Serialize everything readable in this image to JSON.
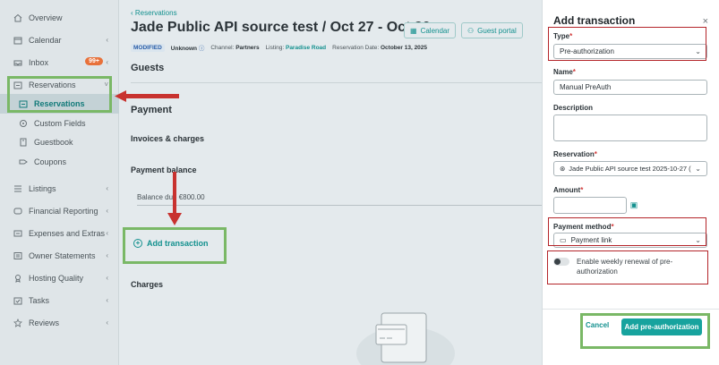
{
  "sidebar": {
    "items": [
      {
        "label": "Overview",
        "icon": "home-icon"
      },
      {
        "label": "Calendar",
        "icon": "calendar-icon"
      },
      {
        "label": "Inbox",
        "icon": "inbox-icon",
        "badge": "99+"
      },
      {
        "label": "Reservations",
        "icon": "calendar-check-icon"
      },
      {
        "label": "Reservations",
        "icon": "calendar-check-icon"
      },
      {
        "label": "Custom Fields",
        "icon": "tag-icon"
      },
      {
        "label": "Guestbook",
        "icon": "book-icon"
      },
      {
        "label": "Coupons",
        "icon": "coupon-icon"
      },
      {
        "label": "Listings",
        "icon": "list-icon"
      },
      {
        "label": "Financial Reporting",
        "icon": "chart-icon"
      },
      {
        "label": "Expenses and Extras",
        "icon": "receipt-icon"
      },
      {
        "label": "Owner Statements",
        "icon": "statement-icon"
      },
      {
        "label": "Hosting Quality",
        "icon": "quality-icon"
      },
      {
        "label": "Tasks",
        "icon": "tasks-icon"
      },
      {
        "label": "Reviews",
        "icon": "star-icon"
      }
    ]
  },
  "main": {
    "breadcrumb": "Reservations",
    "title": "Jade Public API source test / Oct 27 - Oct 30 ...",
    "calendar_btn": "Calendar",
    "guest_portal_btn": "Guest portal",
    "meta": {
      "status": "MODIFIED",
      "unknown": "Unknown",
      "channel_label": "Channel:",
      "channel": "Partners",
      "listing_label": "Listing:",
      "listing": "Paradise Road",
      "date_label": "Reservation Date:",
      "date": "October 13, 2025"
    },
    "guests": "Guests",
    "payment": "Payment",
    "invoices": "Invoices & charges",
    "payment_balance": "Payment balance",
    "balance_due": "Balance due €800.00",
    "add_transaction": "Add transaction",
    "charges": "Charges"
  },
  "panel": {
    "title": "Add transaction",
    "type_label": "Type",
    "type_value": "Pre-authorization",
    "name_label": "Name",
    "name_value": "Manual PreAuth",
    "description_label": "Description",
    "reservation_label": "Reservation",
    "reservation_value": "Jade Public API source test 2025-10-27 (",
    "amount_label": "Amount",
    "payment_method_label": "Payment method",
    "payment_method_value": "Payment link",
    "toggle_label": "Enable weekly renewal of pre-authorization",
    "cancel": "Cancel",
    "submit": "Add pre-authorization",
    "req": "*"
  }
}
